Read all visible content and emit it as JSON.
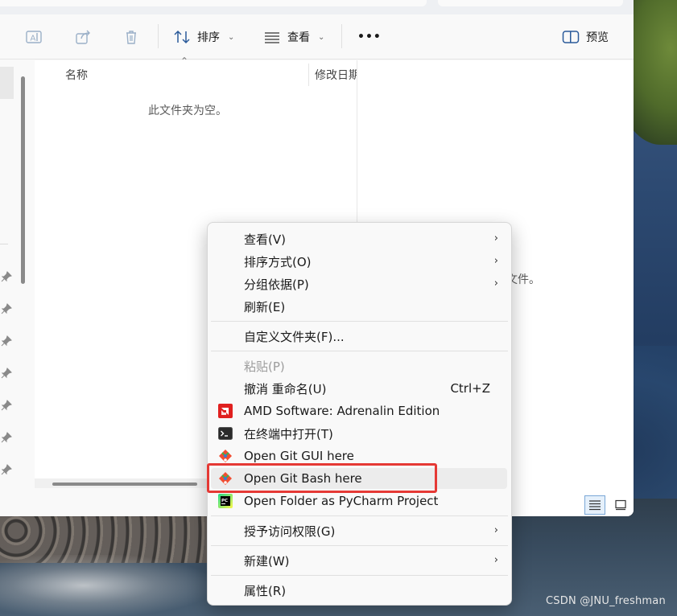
{
  "toolbar": {
    "sort_label": "排序",
    "view_label": "查看",
    "more_label": "•••",
    "preview_label": "预览"
  },
  "columns": {
    "name": "名称",
    "date": "修改日期"
  },
  "content": {
    "empty_message": "此文件夹为空。"
  },
  "preview": {
    "message_fragment": "文件。"
  },
  "context_menu": {
    "items": [
      {
        "label": "查看(V)",
        "submenu": true
      },
      {
        "label": "排序方式(O)",
        "submenu": true
      },
      {
        "label": "分组依据(P)",
        "submenu": true
      },
      {
        "label": "刷新(E)"
      },
      {
        "label": "自定义文件夹(F)..."
      },
      {
        "label": "粘贴(P)",
        "disabled": true
      },
      {
        "label": "撤消 重命名(U)",
        "shortcut": "Ctrl+Z"
      },
      {
        "label": "AMD Software: Adrenalin Edition",
        "icon": "amd-icon"
      },
      {
        "label": "在终端中打开(T)",
        "icon": "terminal-icon"
      },
      {
        "label": "Open Git GUI here",
        "icon": "git-gui-icon"
      },
      {
        "label": "Open Git Bash here",
        "icon": "git-bash-icon",
        "highlighted": true
      },
      {
        "label": "Open Folder as PyCharm Project",
        "icon": "pycharm-icon"
      },
      {
        "label": "授予访问权限(G)",
        "submenu": true
      },
      {
        "label": "新建(W)",
        "submenu": true
      },
      {
        "label": "属性(R)"
      }
    ]
  },
  "watermark": "CSDN @JNU_freshman",
  "colors": {
    "highlight_border": "#e53935",
    "amd_red": "#e0201f",
    "git_orange": "#f14e32"
  }
}
